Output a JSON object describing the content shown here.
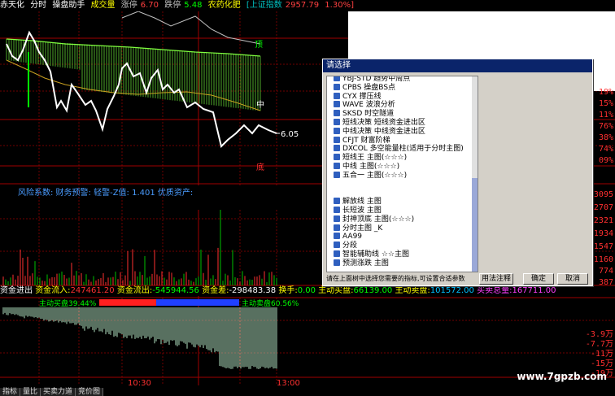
{
  "header": {
    "stock": "赤天化",
    "mode": "分时",
    "helper": "操盘助手",
    "vol_label": "成交量",
    "up_label": "涨停",
    "up_val": "6.70",
    "down_label": "跌停",
    "down_val": "5.48",
    "sector": "农药化肥",
    "index": "[上证指数",
    "index_val": "2957.79",
    "index_pct": "1.30%]"
  },
  "chart_labels": {
    "top": "顶",
    "mid": "中",
    "bottom": "底",
    "price": "6.05"
  },
  "right_axis": [
    "19%",
    "15%",
    "11%",
    "76%",
    "38%",
    "74%",
    "09%",
    "3095",
    "2707",
    "2321",
    "1934",
    "1547",
    "1160",
    "774",
    "387",
    "-3.9万",
    "-7.7万",
    "-11万",
    "-15万",
    "-19万"
  ],
  "risk_text": "风险系数: 财务预警: 轻警-Z值: 1.401 优质资产:",
  "fund": {
    "inflow_label": "资金进出",
    "in_label": "资金流入:",
    "in_val": "247461.20",
    "out_label": "资金流出:",
    "out_val": "-545944.56",
    "diff_label": "资金差:",
    "diff_val": "-298483.38",
    "turn_label": "换手:",
    "turn_val": "0.00",
    "buy_label": "主动买盘:",
    "buy_val": "66139.00",
    "sell_label": "主动卖盘:",
    "sell_val": "101572.00",
    "total_label": "买卖总量:",
    "total_val": "167711.00"
  },
  "buy_pct": "主动买盘39.44%",
  "sell_pct": "主动卖盘60.56%",
  "x_ticks": [
    "10:30",
    "13:00"
  ],
  "tabs": [
    "指标",
    "量比",
    "买卖力道",
    "竞价图"
  ],
  "dialog": {
    "title": "请选择",
    "items": [
      "YBJ-STD 趋势中周点",
      "CPBS 操盘BS点",
      "CYX 撑压线",
      "WAVE 波浪分析",
      "SKSD 时空隧道",
      "短线决策 短线资金进出区",
      "中线决策 中线资金进出区",
      "CFJT 财富阶梯",
      "DXCOL 多空能量柱(适用于分时主图)",
      "短线王 主图(☆☆☆)",
      "中线 主图(☆☆☆)",
      "五合一 主图(☆☆☆)",
      "",
      "",
      "解放线 主图",
      "长短波 主图",
      "封神顶底 主图(☆☆☆)",
      "分时主图 _K",
      "AA99",
      "分段",
      "智能辅助线 ☆☆主图",
      "预测涨跌 主图"
    ],
    "hint": "请在上面树中选择您需要的指标,可设置合适参数",
    "usage_btn": "用法注释",
    "ok_btn": "确定",
    "cancel_btn": "取消"
  },
  "watermark": "www.7gpzb.com"
}
